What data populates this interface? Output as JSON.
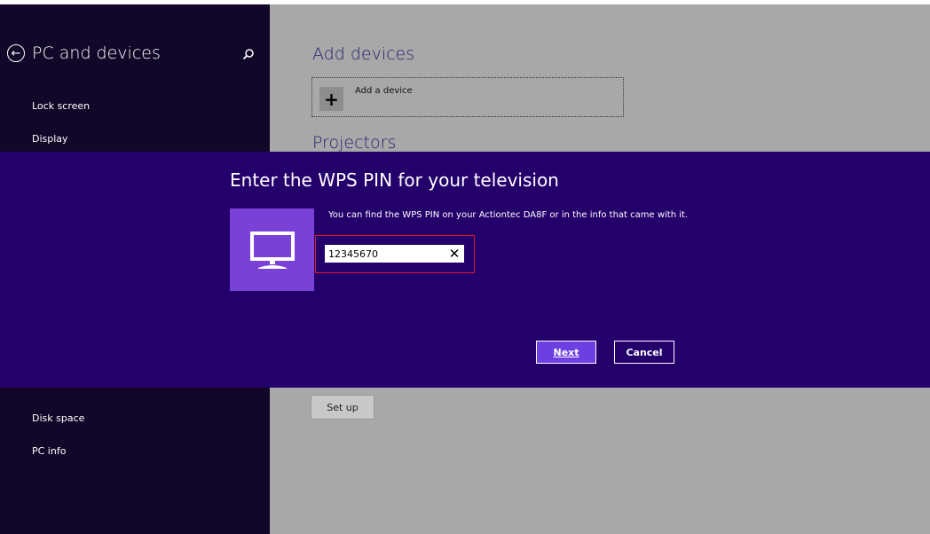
{
  "sidebar": {
    "title": "PC and devices",
    "items": [
      {
        "label": "Lock screen"
      },
      {
        "label": "Display"
      },
      {
        "label": "Disk space"
      },
      {
        "label": "PC info"
      }
    ]
  },
  "content": {
    "add_devices_title": "Add devices",
    "add_device_label": "Add a device",
    "projectors_title": "Projectors",
    "setup_label": "Set up"
  },
  "dialog": {
    "title": "Enter the WPS PIN for your television",
    "message": "You can find the WPS PIN on your Actiontec DA8F or in the info that came with it.",
    "pin_value": "12345670",
    "next_label": "Next",
    "cancel_label": "Cancel"
  },
  "icons": {
    "back": "back-arrow-circle-icon",
    "search": "search-icon",
    "plus": "plus-icon",
    "tv": "monitor-icon",
    "clear": "close-icon"
  },
  "colors": {
    "sidebar_bg": "#120728",
    "dialog_bg": "#24006b",
    "accent": "#7a41d6",
    "next_button": "#6c3fe0",
    "highlight": "#e0182e"
  }
}
